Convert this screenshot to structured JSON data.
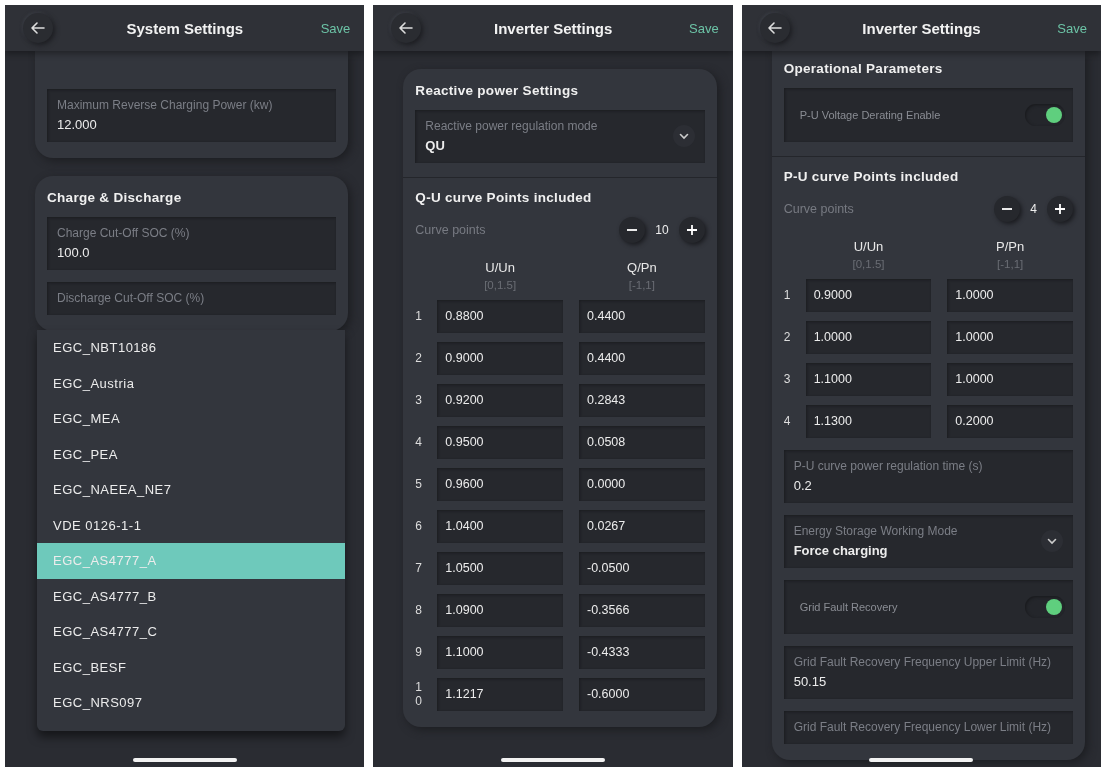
{
  "screens": [
    {
      "title": "System Settings",
      "action": "Save",
      "cards": [
        {
          "clipped": true,
          "blocks": [
            {
              "kind": "field",
              "label": "Maximum Reverse Charging Power (kw)",
              "value": "12.000"
            }
          ]
        },
        {
          "clipped": false,
          "title": "Charge & Discharge",
          "blocks": [
            {
              "kind": "field",
              "label": "Charge Cut-Off SOC (%)",
              "value": "100.0"
            },
            {
              "kind": "field",
              "label": "Discharge Cut-Off SOC (%)"
            }
          ]
        }
      ],
      "dropdown": [
        {
          "label": "EGC_NBT10186",
          "selected": false
        },
        {
          "label": "EGC_Austria",
          "selected": false
        },
        {
          "label": "EGC_MEA",
          "selected": false
        },
        {
          "label": "EGC_PEA",
          "selected": false
        },
        {
          "label": "EGC_NAEEA_NE7",
          "selected": false
        },
        {
          "label": "VDE 0126-1-1",
          "selected": false
        },
        {
          "label": "EGC_AS4777_A",
          "selected": true
        },
        {
          "label": "EGC_AS4777_B",
          "selected": false
        },
        {
          "label": "EGC_AS4777_C",
          "selected": false
        },
        {
          "label": "EGC_BESF",
          "selected": false
        },
        {
          "label": "EGC_NRS097",
          "selected": false
        }
      ]
    },
    {
      "title": "Inverter Settings",
      "action": "Save",
      "cards": [
        {
          "clipped": false,
          "title": "Reactive power Settings",
          "blocks": [
            {
              "kind": "select",
              "label": "Reactive power regulation mode",
              "value": "QU"
            },
            {
              "kind": "curve",
              "title": "Q-U curve Points included",
              "label": "Curve points",
              "count": "10",
              "columns": [
                {
                  "name": "U/Un",
                  "range": "[0,1.5]"
                },
                {
                  "name": "Q/Pn",
                  "range": "[-1,1]"
                }
              ],
              "rows": [
                {
                  "index": "1",
                  "values": [
                    "0.8800",
                    "0.4400"
                  ]
                },
                {
                  "index": "2",
                  "values": [
                    "0.9000",
                    "0.4400"
                  ]
                },
                {
                  "index": "3",
                  "values": [
                    "0.9200",
                    "0.2843"
                  ]
                },
                {
                  "index": "4",
                  "values": [
                    "0.9500",
                    "0.0508"
                  ]
                },
                {
                  "index": "5",
                  "values": [
                    "0.9600",
                    "0.0000"
                  ]
                },
                {
                  "index": "6",
                  "values": [
                    "1.0400",
                    "0.0267"
                  ]
                },
                {
                  "index": "7",
                  "values": [
                    "1.0500",
                    "-0.0500"
                  ]
                },
                {
                  "index": "8",
                  "values": [
                    "1.0900",
                    "-0.3566"
                  ]
                },
                {
                  "index": "9",
                  "values": [
                    "1.1000",
                    "-0.4333"
                  ]
                },
                {
                  "index": "10",
                  "values": [
                    "1.1217",
                    "-0.6000"
                  ]
                }
              ]
            }
          ]
        }
      ]
    },
    {
      "title": "Inverter Settings",
      "action": "Save",
      "cards": [
        {
          "clipped": true,
          "title": "Operational Parameters",
          "blocks": [
            {
              "kind": "toggle",
              "label": "P-U Voltage Derating Enable",
              "on": true
            },
            {
              "kind": "curve",
              "title": "P-U curve Points included",
              "label": "Curve points",
              "count": "4",
              "columns": [
                {
                  "name": "U/Un",
                  "range": "[0,1.5]"
                },
                {
                  "name": "P/Pn",
                  "range": "[-1,1]"
                }
              ],
              "rows": [
                {
                  "index": "1",
                  "values": [
                    "0.9000",
                    "1.0000"
                  ]
                },
                {
                  "index": "2",
                  "values": [
                    "1.0000",
                    "1.0000"
                  ]
                },
                {
                  "index": "3",
                  "values": [
                    "1.1000",
                    "1.0000"
                  ]
                },
                {
                  "index": "4",
                  "values": [
                    "1.1300",
                    "0.2000"
                  ]
                }
              ]
            },
            {
              "kind": "field",
              "label": "P-U curve power regulation time (s)",
              "value": "0.2"
            },
            {
              "kind": "select",
              "label": "Energy Storage Working Mode",
              "value": "Force charging"
            },
            {
              "kind": "toggle",
              "label": "Grid Fault Recovery",
              "on": true
            },
            {
              "kind": "field",
              "label": "Grid Fault Recovery Frequency Upper Limit (Hz)",
              "value": "50.15"
            },
            {
              "kind": "field",
              "label": "Grid Fault Recovery Frequency Lower Limit (Hz)"
            }
          ]
        }
      ]
    }
  ]
}
